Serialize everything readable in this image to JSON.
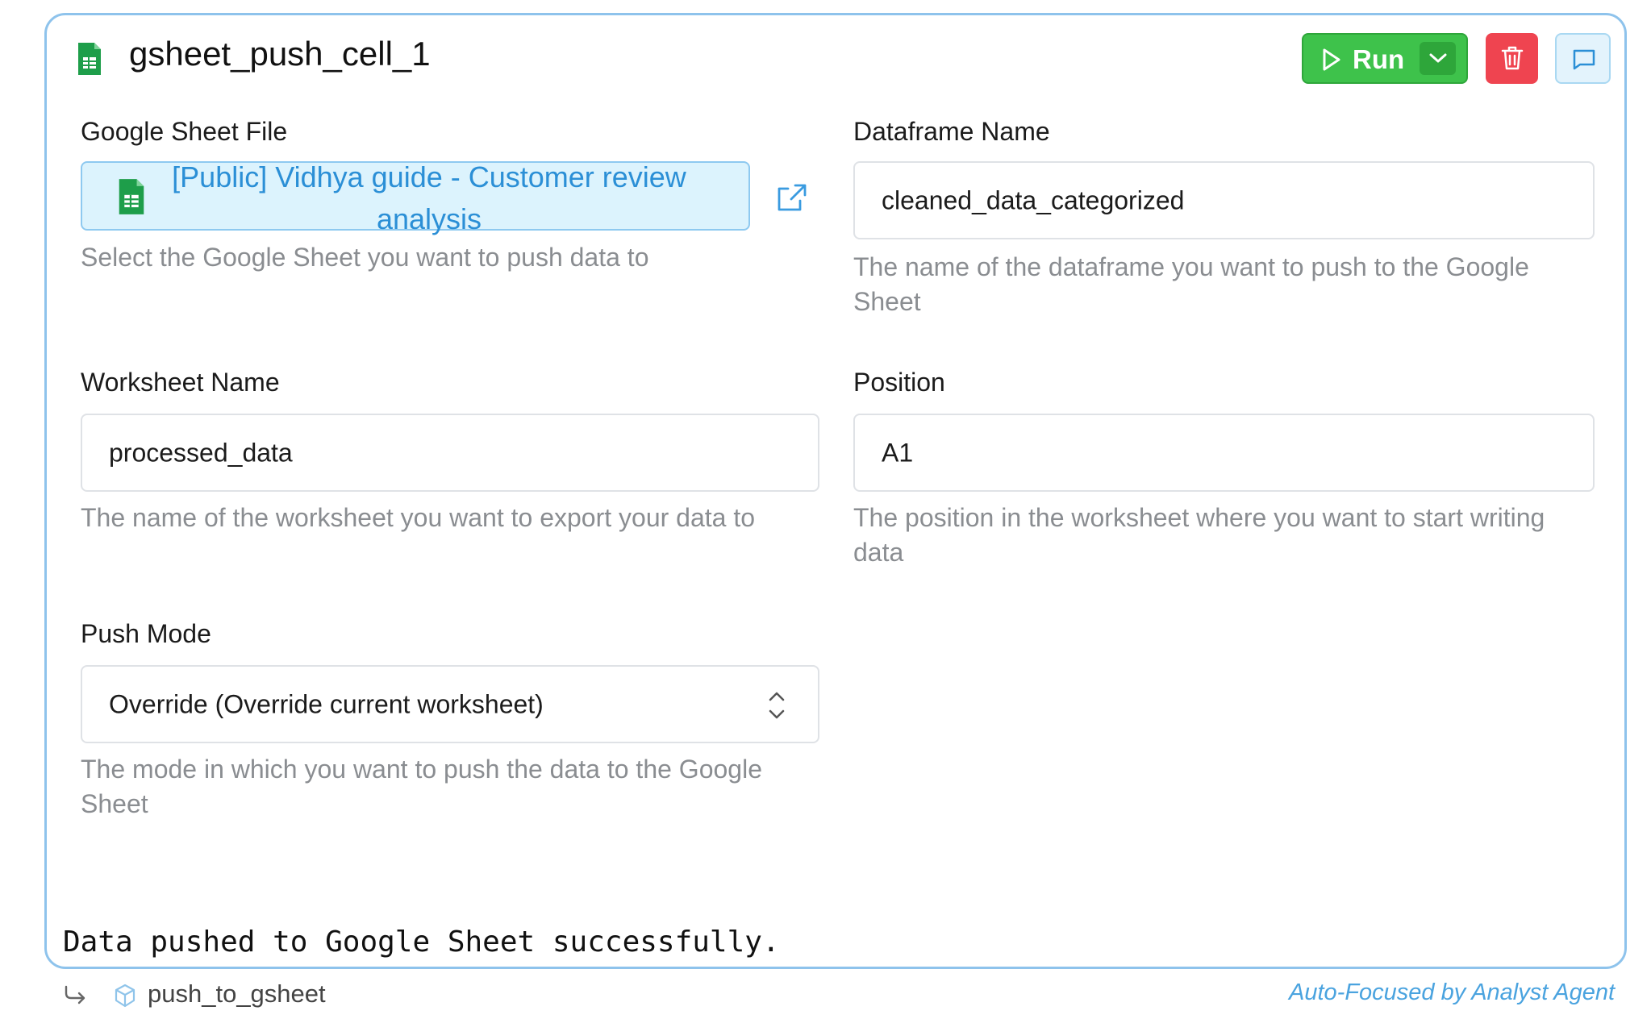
{
  "cell": {
    "title": "gsheet_push_cell_1",
    "run_label": "Run"
  },
  "fields": {
    "google_sheet_file": {
      "label": "Google Sheet File",
      "value": "[Public] Vidhya guide - Customer review analysis",
      "help": "Select the Google Sheet you want to push data to"
    },
    "dataframe_name": {
      "label": "Dataframe Name",
      "value": "cleaned_data_categorized",
      "help": "The name of the dataframe you want to push to the Google Sheet"
    },
    "worksheet_name": {
      "label": "Worksheet Name",
      "value": "processed_data",
      "help": "The name of the worksheet you want to export your data to"
    },
    "position": {
      "label": "Position",
      "value": "A1",
      "help": "The position in the worksheet where you want to start writing data"
    },
    "push_mode": {
      "label": "Push Mode",
      "value": "Override (Override current worksheet)",
      "help": "The mode in which you want to push the data to the Google Sheet"
    }
  },
  "output": {
    "message": "Data pushed to Google Sheet successfully."
  },
  "footer": {
    "function_name": "push_to_gsheet",
    "agent_note": "Auto-Focused by Analyst Agent"
  },
  "icons": {
    "sheet": "google-sheets-icon",
    "play": "play-icon",
    "caret": "chevron-down-icon",
    "delete": "trash-icon",
    "comment": "comment-icon",
    "external": "external-link-icon",
    "select": "chevron-up-down-icon",
    "return": "return-arrow-icon",
    "cube": "cube-icon"
  },
  "colors": {
    "accent_border": "#8ec3ec",
    "run_green": "#3ec24b",
    "delete_red": "#ef4450",
    "link_blue": "#2b8fd6",
    "sheets_green": "#1e9e4a"
  }
}
